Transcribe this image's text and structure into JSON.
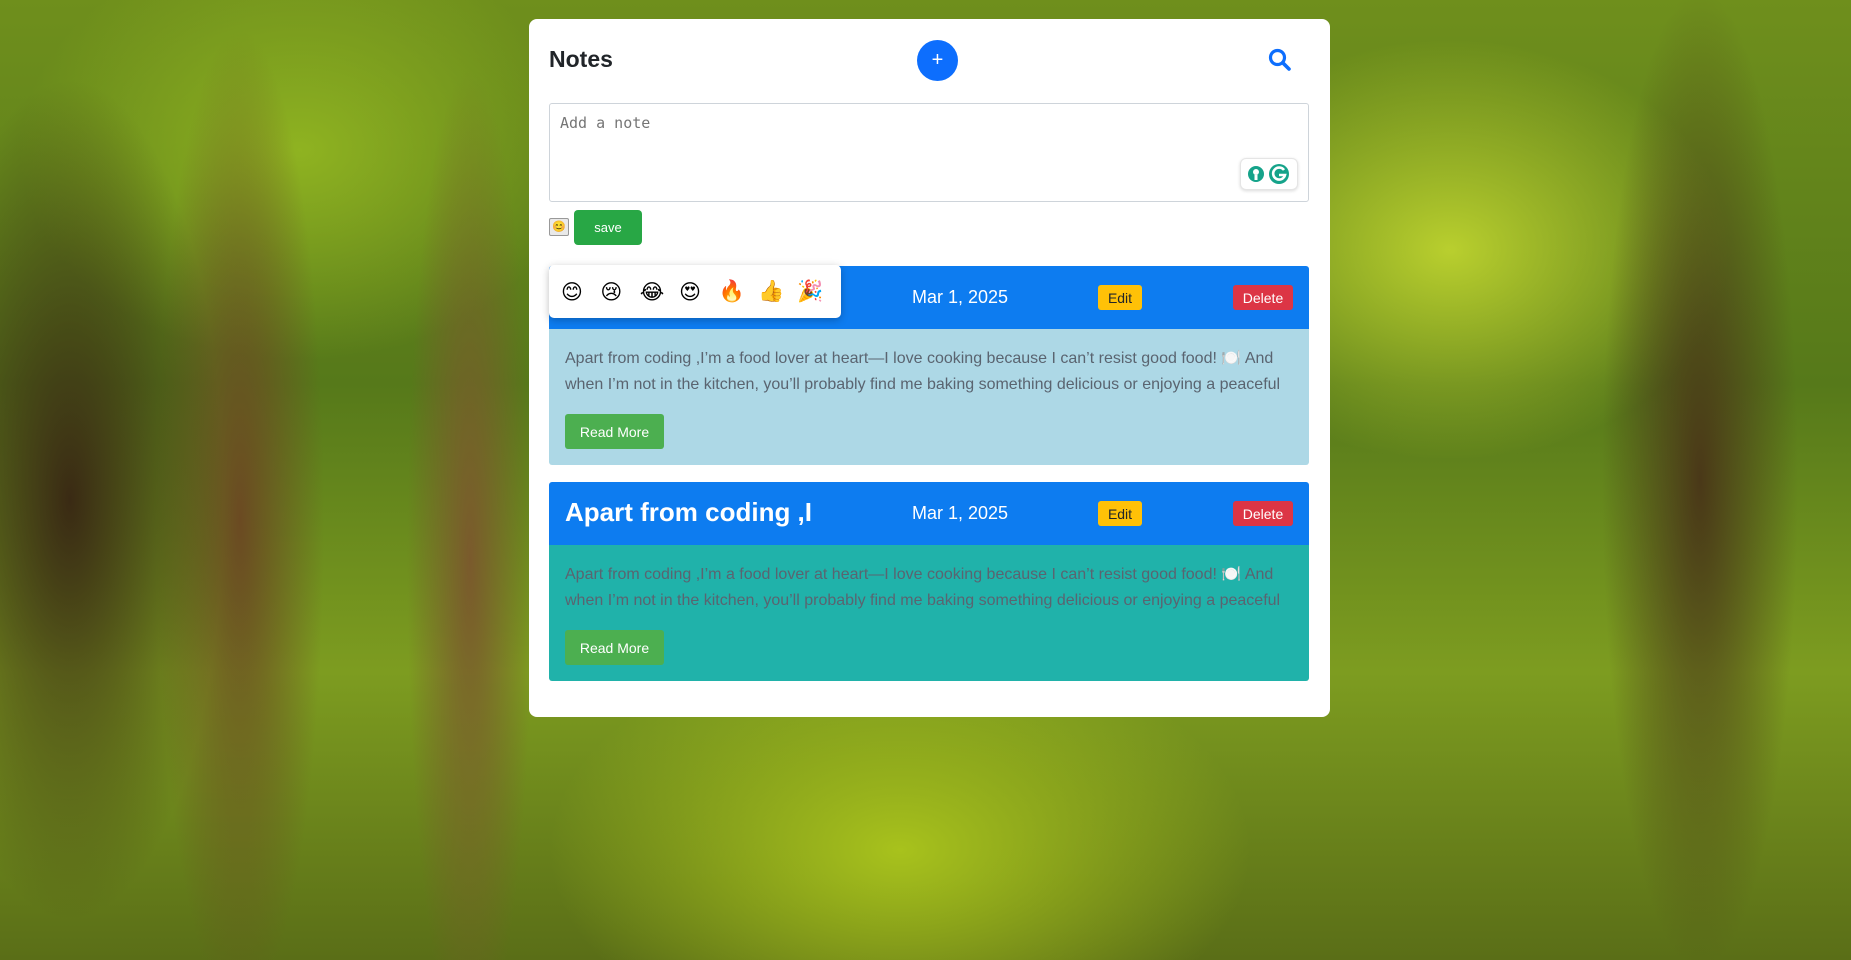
{
  "app": {
    "title": "Notes",
    "add_label": "+"
  },
  "icons": {
    "add": "plus-icon",
    "search": "search-icon",
    "grammarly": "grammarly-icon"
  },
  "editor": {
    "placeholder": "Add a note",
    "emoji_toggle": "😊",
    "save_label": "save"
  },
  "emoji_picker": {
    "options": [
      "😊",
      "😢",
      "😂",
      "😍",
      "🔥",
      "👍",
      "🎉"
    ]
  },
  "notes": [
    {
      "title": "",
      "date": "Mar 1, 2025",
      "edit_label": "Edit",
      "delete_label": "Delete",
      "text": "Apart from coding ,I’m a food lover at heart—I love cooking because I can’t resist good food! 🍽️ And when I’m not in the kitchen, you’ll probably find me baking something delicious or enjoying a peaceful",
      "read_more_label": "Read More",
      "body_color": "#add8e6"
    },
    {
      "title": "Apart from coding ,I",
      "date": "Mar 1, 2025",
      "edit_label": "Edit",
      "delete_label": "Delete",
      "text": "Apart from coding ,I’m a food lover at heart—I love cooking because I can’t resist good food! 🍽️ And when I’m not in the kitchen, you’ll probably find me baking something delicious or enjoying a peaceful",
      "read_more_label": "Read More",
      "body_color": "#20b2aa"
    }
  ],
  "colors": {
    "primary": "#0d6efd",
    "note_header": "#0d7cf0",
    "save": "#28a745",
    "edit": "#ffc107",
    "delete": "#dc3545",
    "read_more": "#4caf50"
  }
}
